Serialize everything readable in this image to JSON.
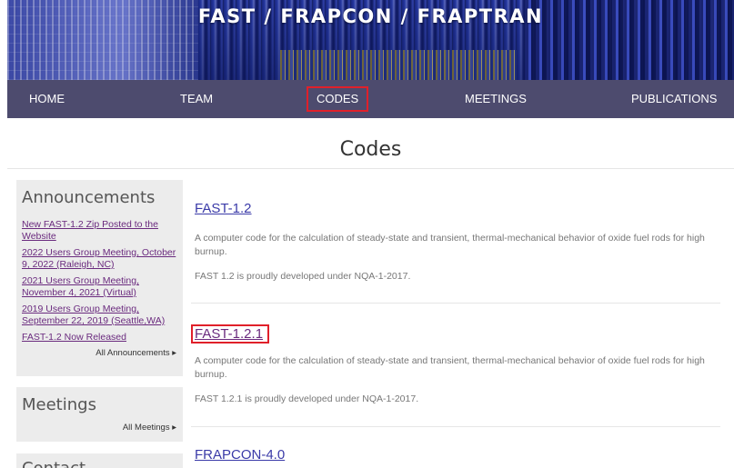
{
  "banner": {
    "title": "FAST / FRAPCON / FRAPTRAN"
  },
  "nav": {
    "home": "HOME",
    "team": "TEAM",
    "codes": "CODES",
    "meetings": "MEETINGS",
    "publications": "PUBLICATIONS"
  },
  "page": {
    "title": "Codes"
  },
  "sidebar": {
    "announcements": {
      "title": "Announcements",
      "items": [
        {
          "label": "New FAST-1.2 Zip Posted to the Website"
        },
        {
          "label": "2022 Users Group Meeting, October 9, 2022 (Raleigh, NC)"
        },
        {
          "label": "2021 Users Group Meeting, November 4, 2021 (Virtual)"
        },
        {
          "label": "2019 Users Group Meeting, September 22, 2019 (Seattle,WA)"
        },
        {
          "label": "FAST-1.2 Now Released"
        }
      ],
      "all_label": "All Announcements ▸"
    },
    "meetings": {
      "title": "Meetings",
      "all_label": "All Meetings ▸"
    },
    "contact": {
      "title": "Contact"
    }
  },
  "codes": [
    {
      "title": "FAST-1.2",
      "description": "A computer code for the calculation of steady-state and transient, thermal-mechanical behavior of oxide fuel rods for high burnup.",
      "note": "FAST 1.2 is proudly developed under NQA-1-2017."
    },
    {
      "title": "FAST-1.2.1",
      "description": "A computer code for the calculation of steady-state and transient, thermal-mechanical behavior of oxide fuel rods for high burnup.",
      "note": "FAST 1.2.1 is proudly developed under NQA-1-2017."
    },
    {
      "title": "FRAPCON-4.0"
    }
  ],
  "colors": {
    "nav_bg": "#4d4b6e",
    "highlight": "#e0202a",
    "link_blue": "#3a3aa8",
    "link_visited": "#6a2a7e",
    "sidebar_bg": "#ececec"
  }
}
